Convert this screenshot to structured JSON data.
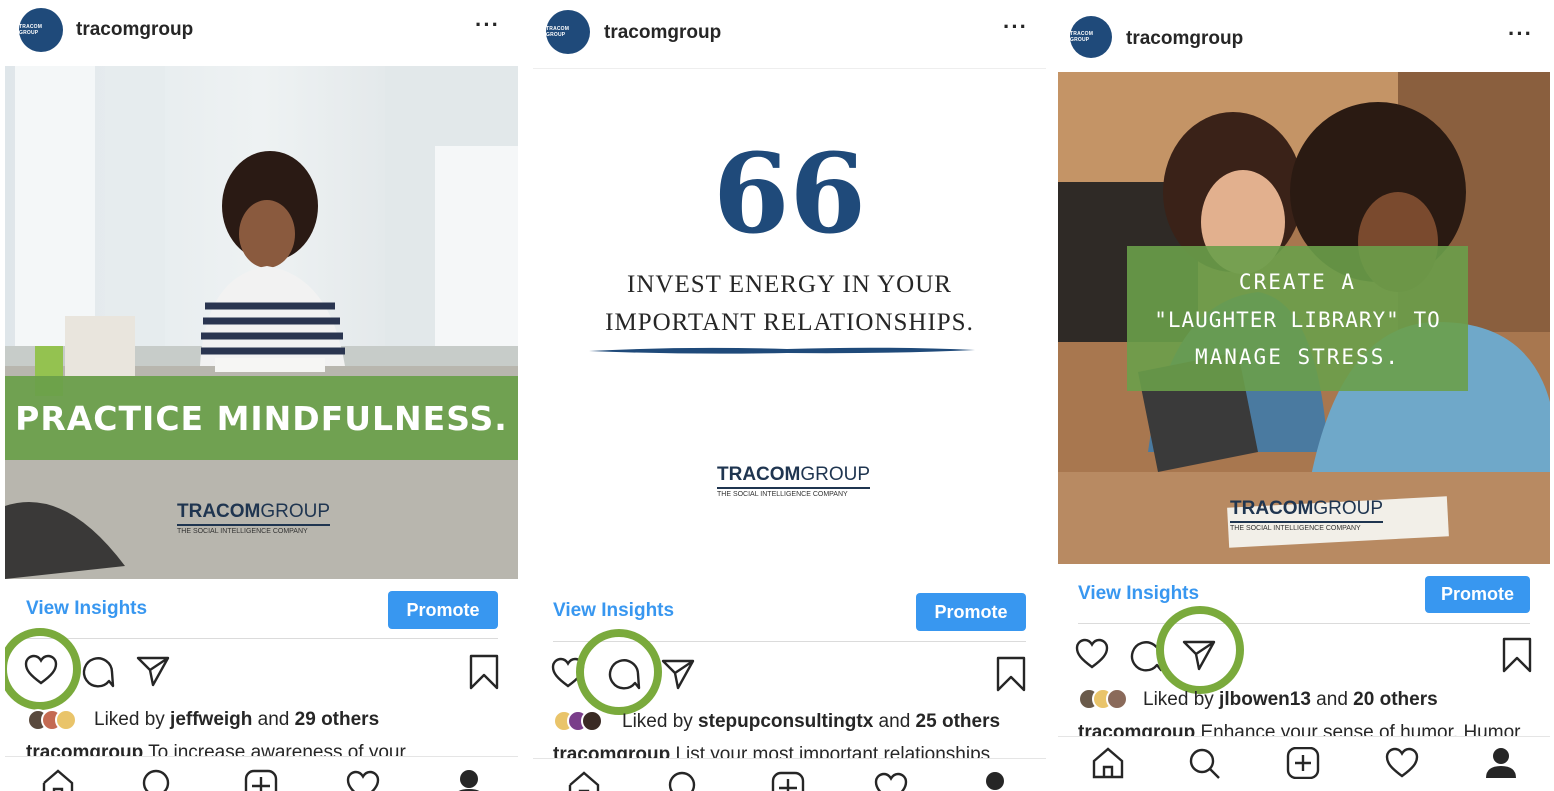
{
  "posts": [
    {
      "username": "tracomgroup",
      "avatar_text": "TRACOM GROUP",
      "overlay_text": "PRACTICE MINDFULNESS.",
      "logo_main": "TRACOM",
      "logo_group": "GROUP",
      "logo_tag": "THE SOCIAL INTELLIGENCE COMPANY",
      "view_insights": "View Insights",
      "promote": "Promote",
      "liked_prefix": "Liked by ",
      "liked_user": "jeffweigh",
      "liked_and": " and ",
      "liked_others": "29 others",
      "caption_user": "tracomgroup",
      "caption_text": " To increase awareness of your",
      "highlighted_action": "like"
    },
    {
      "username": "tracomgroup",
      "avatar_text": "TRACOM GROUP",
      "quote_mark": "66",
      "quote_line1": "INVEST ENERGY IN YOUR",
      "quote_line2": "IMPORTANT RELATIONSHIPS.",
      "logo_main": "TRACOM",
      "logo_group": "GROUP",
      "logo_tag": "THE SOCIAL INTELLIGENCE COMPANY",
      "view_insights": "View Insights",
      "promote": "Promote",
      "liked_prefix": "Liked by ",
      "liked_user": "stepupconsultingtx",
      "liked_and": " and ",
      "liked_others": "25 others",
      "caption_user": "tracomgroup",
      "caption_text": " List your most important relationships",
      "highlighted_action": "comment"
    },
    {
      "username": "tracomgroup",
      "avatar_text": "TRACOM GROUP",
      "overlay_line1": "CREATE A",
      "overlay_line2": "\"LAUGHTER LIBRARY\" TO",
      "overlay_line3": "MANAGE STRESS.",
      "logo_main": "TRACOM",
      "logo_group": "GROUP",
      "logo_tag": "THE SOCIAL INTELLIGENCE COMPANY",
      "view_insights": "View Insights",
      "promote": "Promote",
      "liked_prefix": "Liked by ",
      "liked_user": "jlbowen13",
      "liked_and": " and ",
      "liked_others": "20 others",
      "caption_user": "tracomgroup",
      "caption_text": " Enhance your sense of humor. Humor",
      "highlighted_action": "share"
    }
  ],
  "colors": {
    "accent_blue": "#3897f0",
    "highlight_green": "#7aaa3c",
    "brand_navy": "#1f4a7a",
    "overlay_green": "#6a9f4a"
  },
  "icons": [
    "heart-icon",
    "comment-icon",
    "share-icon",
    "bookmark-icon",
    "home-icon",
    "search-icon",
    "add-icon",
    "activity-icon",
    "profile-icon"
  ]
}
